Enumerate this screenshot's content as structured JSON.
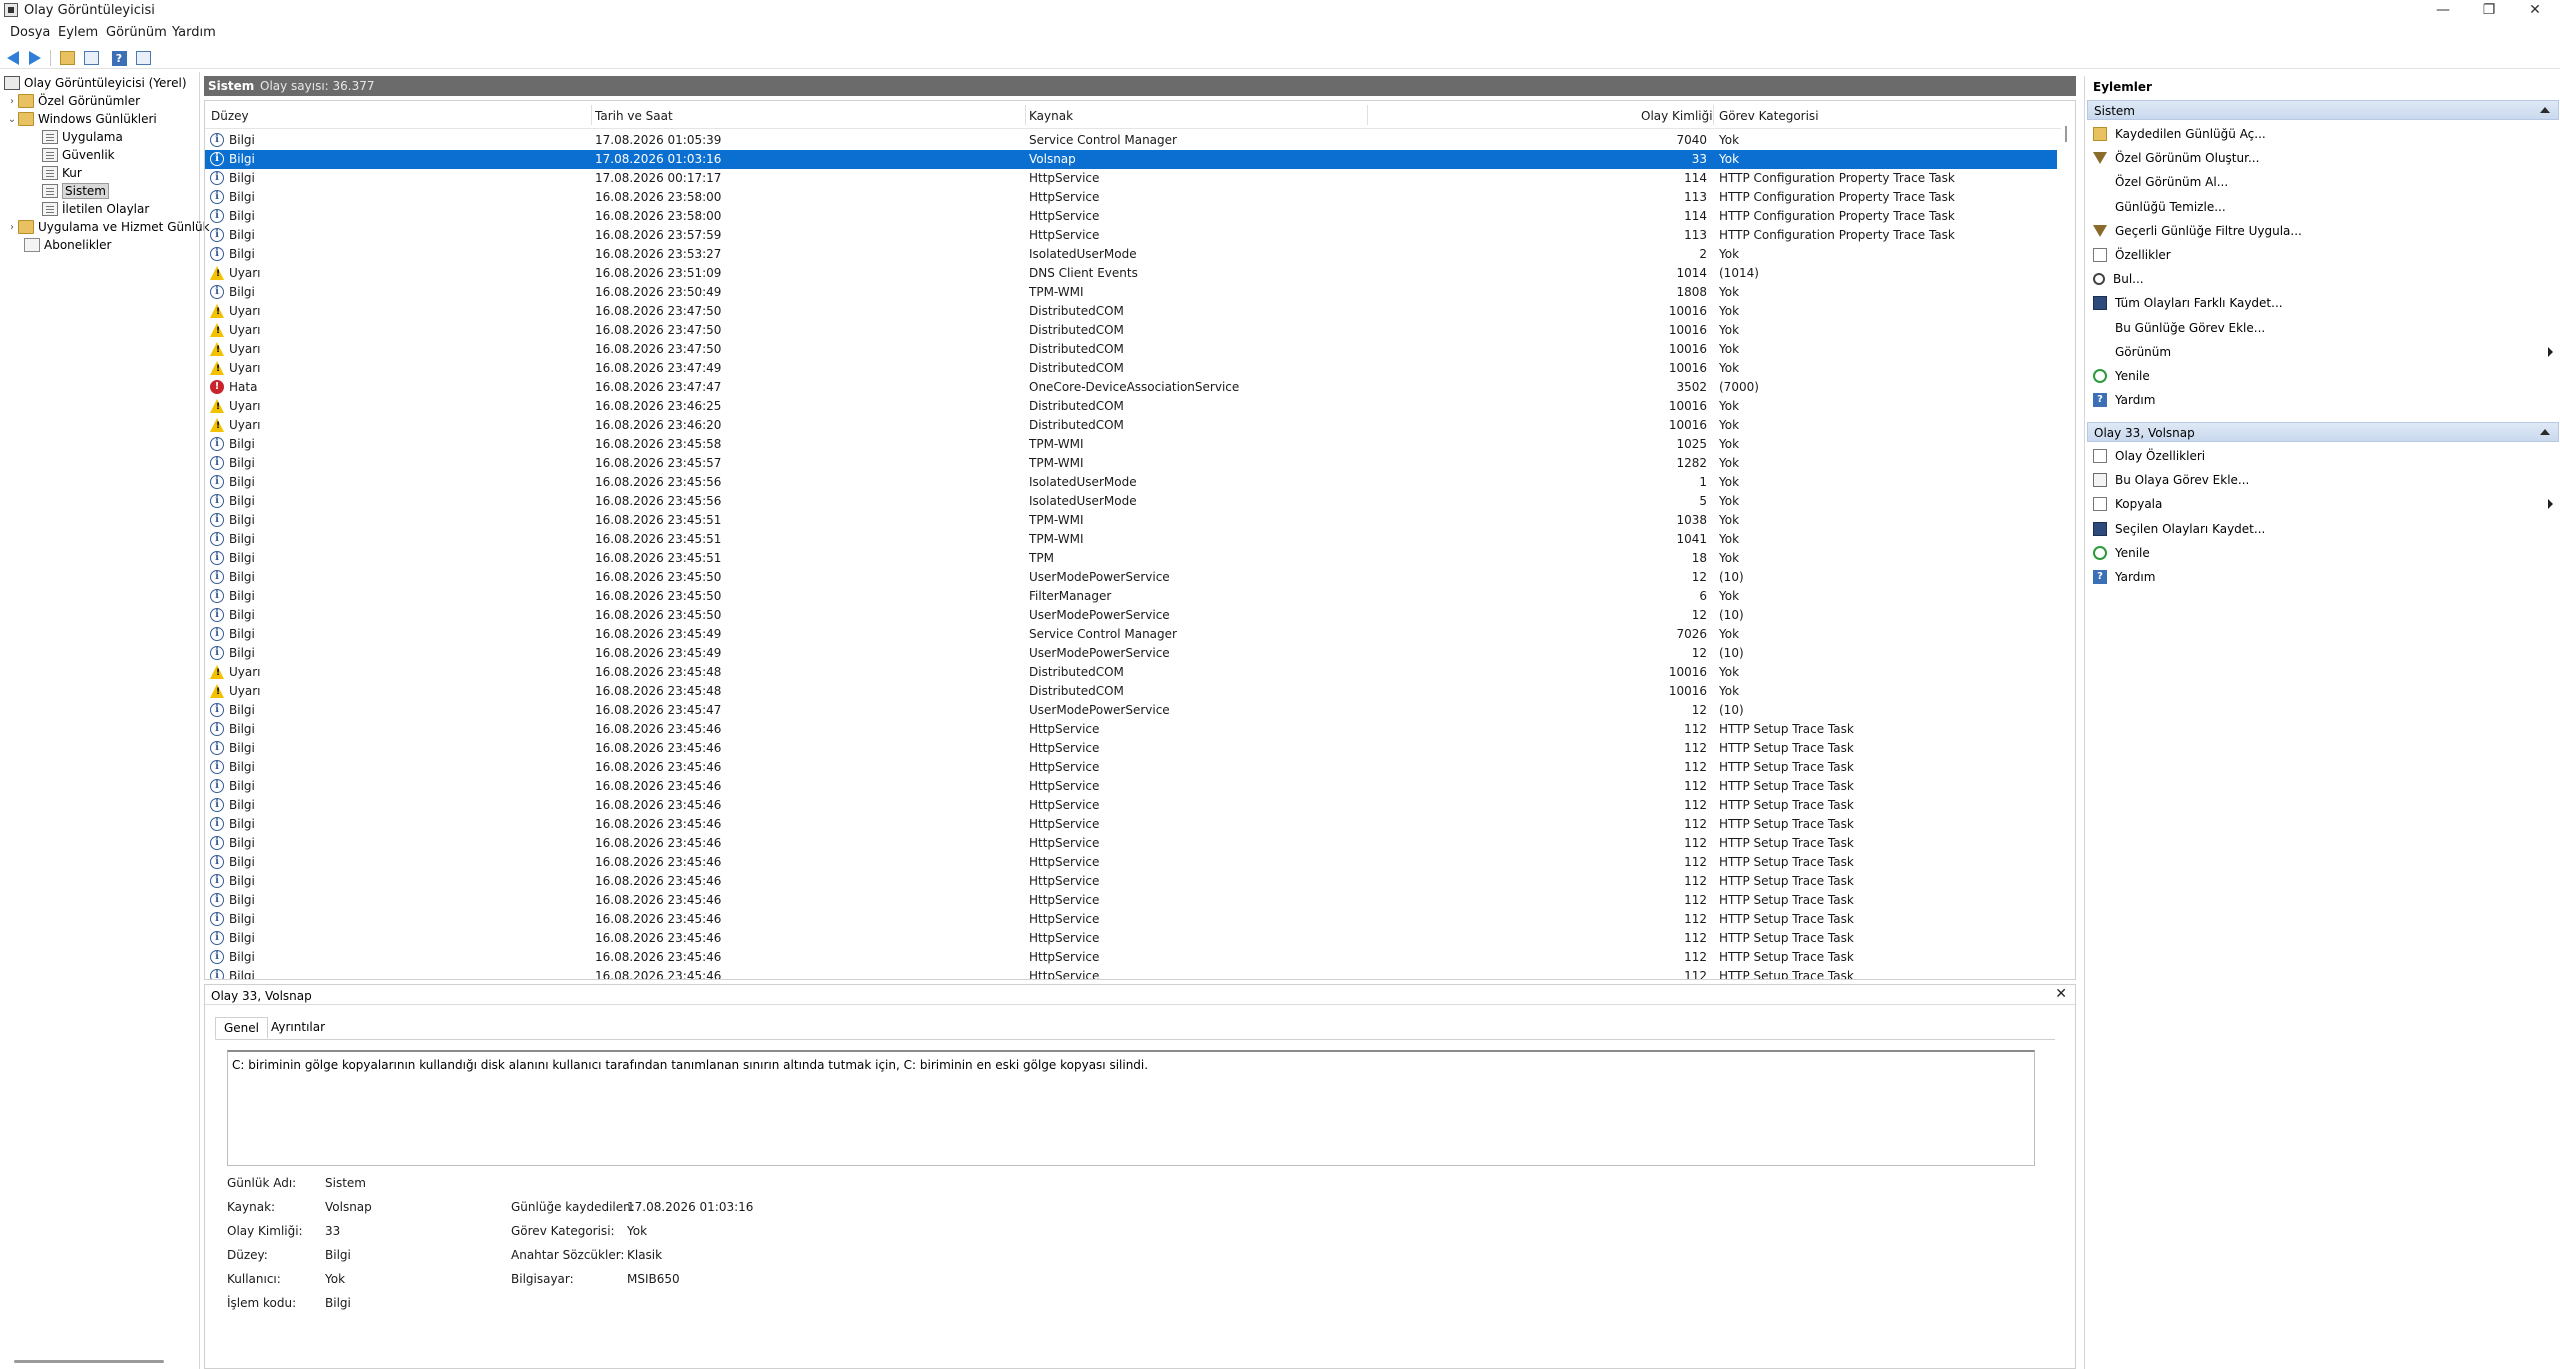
{
  "window": {
    "title": "Olay Görüntüleyicisi",
    "controls": [
      "—",
      "❐",
      "✕"
    ]
  },
  "menu": [
    "Dosya",
    "Eylem",
    "Görünüm",
    "Yardım"
  ],
  "tree": {
    "root": "Olay Görüntüleyicisi (Yerel)",
    "custom_views": "Özel Görünümler",
    "windows_logs": "Windows Günlükleri",
    "logs": [
      "Uygulama",
      "Güvenlik",
      "Kur",
      "Sistem",
      "İletilen Olaylar"
    ],
    "apps_services": "Uygulama ve Hizmet Günlük",
    "subscriptions": "Abonelikler"
  },
  "center": {
    "title": "Sistem",
    "count_text": "Olay sayısı: 36.377"
  },
  "columns": {
    "level": "Düzey",
    "date": "Tarih ve Saat",
    "source": "Kaynak",
    "event_id": "Olay Kimliği",
    "category": "Görev Kategorisi"
  },
  "events": [
    {
      "level": "info",
      "level_text": "Bilgi",
      "date": "17.08.2026 01:05:39",
      "source": "Service Control Manager",
      "id": "7040",
      "cat": "Yok"
    },
    {
      "level": "info",
      "level_text": "Bilgi",
      "date": "17.08.2026 01:03:16",
      "source": "Volsnap",
      "id": "33",
      "cat": "Yok",
      "selected": true
    },
    {
      "level": "info",
      "level_text": "Bilgi",
      "date": "17.08.2026 00:17:17",
      "source": "HttpService",
      "id": "114",
      "cat": "HTTP Configuration Property Trace Task"
    },
    {
      "level": "info",
      "level_text": "Bilgi",
      "date": "16.08.2026 23:58:00",
      "source": "HttpService",
      "id": "113",
      "cat": "HTTP Configuration Property Trace Task"
    },
    {
      "level": "info",
      "level_text": "Bilgi",
      "date": "16.08.2026 23:58:00",
      "source": "HttpService",
      "id": "114",
      "cat": "HTTP Configuration Property Trace Task"
    },
    {
      "level": "info",
      "level_text": "Bilgi",
      "date": "16.08.2026 23:57:59",
      "source": "HttpService",
      "id": "113",
      "cat": "HTTP Configuration Property Trace Task"
    },
    {
      "level": "info",
      "level_text": "Bilgi",
      "date": "16.08.2026 23:53:27",
      "source": "IsolatedUserMode",
      "id": "2",
      "cat": "Yok"
    },
    {
      "level": "warn",
      "level_text": "Uyarı",
      "date": "16.08.2026 23:51:09",
      "source": "DNS Client Events",
      "id": "1014",
      "cat": "(1014)"
    },
    {
      "level": "info",
      "level_text": "Bilgi",
      "date": "16.08.2026 23:50:49",
      "source": "TPM-WMI",
      "id": "1808",
      "cat": "Yok"
    },
    {
      "level": "warn",
      "level_text": "Uyarı",
      "date": "16.08.2026 23:47:50",
      "source": "DistributedCOM",
      "id": "10016",
      "cat": "Yok"
    },
    {
      "level": "warn",
      "level_text": "Uyarı",
      "date": "16.08.2026 23:47:50",
      "source": "DistributedCOM",
      "id": "10016",
      "cat": "Yok"
    },
    {
      "level": "warn",
      "level_text": "Uyarı",
      "date": "16.08.2026 23:47:50",
      "source": "DistributedCOM",
      "id": "10016",
      "cat": "Yok"
    },
    {
      "level": "warn",
      "level_text": "Uyarı",
      "date": "16.08.2026 23:47:49",
      "source": "DistributedCOM",
      "id": "10016",
      "cat": "Yok"
    },
    {
      "level": "error",
      "level_text": "Hata",
      "date": "16.08.2026 23:47:47",
      "source": "OneCore-DeviceAssociationService",
      "id": "3502",
      "cat": "(7000)"
    },
    {
      "level": "warn",
      "level_text": "Uyarı",
      "date": "16.08.2026 23:46:25",
      "source": "DistributedCOM",
      "id": "10016",
      "cat": "Yok"
    },
    {
      "level": "warn",
      "level_text": "Uyarı",
      "date": "16.08.2026 23:46:20",
      "source": "DistributedCOM",
      "id": "10016",
      "cat": "Yok"
    },
    {
      "level": "info",
      "level_text": "Bilgi",
      "date": "16.08.2026 23:45:58",
      "source": "TPM-WMI",
      "id": "1025",
      "cat": "Yok"
    },
    {
      "level": "info",
      "level_text": "Bilgi",
      "date": "16.08.2026 23:45:57",
      "source": "TPM-WMI",
      "id": "1282",
      "cat": "Yok"
    },
    {
      "level": "info",
      "level_text": "Bilgi",
      "date": "16.08.2026 23:45:56",
      "source": "IsolatedUserMode",
      "id": "1",
      "cat": "Yok"
    },
    {
      "level": "info",
      "level_text": "Bilgi",
      "date": "16.08.2026 23:45:56",
      "source": "IsolatedUserMode",
      "id": "5",
      "cat": "Yok"
    },
    {
      "level": "info",
      "level_text": "Bilgi",
      "date": "16.08.2026 23:45:51",
      "source": "TPM-WMI",
      "id": "1038",
      "cat": "Yok"
    },
    {
      "level": "info",
      "level_text": "Bilgi",
      "date": "16.08.2026 23:45:51",
      "source": "TPM-WMI",
      "id": "1041",
      "cat": "Yok"
    },
    {
      "level": "info",
      "level_text": "Bilgi",
      "date": "16.08.2026 23:45:51",
      "source": "TPM",
      "id": "18",
      "cat": "Yok"
    },
    {
      "level": "info",
      "level_text": "Bilgi",
      "date": "16.08.2026 23:45:50",
      "source": "UserModePowerService",
      "id": "12",
      "cat": "(10)"
    },
    {
      "level": "info",
      "level_text": "Bilgi",
      "date": "16.08.2026 23:45:50",
      "source": "FilterManager",
      "id": "6",
      "cat": "Yok"
    },
    {
      "level": "info",
      "level_text": "Bilgi",
      "date": "16.08.2026 23:45:50",
      "source": "UserModePowerService",
      "id": "12",
      "cat": "(10)"
    },
    {
      "level": "info",
      "level_text": "Bilgi",
      "date": "16.08.2026 23:45:49",
      "source": "Service Control Manager",
      "id": "7026",
      "cat": "Yok"
    },
    {
      "level": "info",
      "level_text": "Bilgi",
      "date": "16.08.2026 23:45:49",
      "source": "UserModePowerService",
      "id": "12",
      "cat": "(10)"
    },
    {
      "level": "warn",
      "level_text": "Uyarı",
      "date": "16.08.2026 23:45:48",
      "source": "DistributedCOM",
      "id": "10016",
      "cat": "Yok"
    },
    {
      "level": "warn",
      "level_text": "Uyarı",
      "date": "16.08.2026 23:45:48",
      "source": "DistributedCOM",
      "id": "10016",
      "cat": "Yok"
    },
    {
      "level": "info",
      "level_text": "Bilgi",
      "date": "16.08.2026 23:45:47",
      "source": "UserModePowerService",
      "id": "12",
      "cat": "(10)"
    },
    {
      "level": "info",
      "level_text": "Bilgi",
      "date": "16.08.2026 23:45:46",
      "source": "HttpService",
      "id": "112",
      "cat": "HTTP Setup Trace Task"
    },
    {
      "level": "info",
      "level_text": "Bilgi",
      "date": "16.08.2026 23:45:46",
      "source": "HttpService",
      "id": "112",
      "cat": "HTTP Setup Trace Task"
    },
    {
      "level": "info",
      "level_text": "Bilgi",
      "date": "16.08.2026 23:45:46",
      "source": "HttpService",
      "id": "112",
      "cat": "HTTP Setup Trace Task"
    },
    {
      "level": "info",
      "level_text": "Bilgi",
      "date": "16.08.2026 23:45:46",
      "source": "HttpService",
      "id": "112",
      "cat": "HTTP Setup Trace Task"
    },
    {
      "level": "info",
      "level_text": "Bilgi",
      "date": "16.08.2026 23:45:46",
      "source": "HttpService",
      "id": "112",
      "cat": "HTTP Setup Trace Task"
    },
    {
      "level": "info",
      "level_text": "Bilgi",
      "date": "16.08.2026 23:45:46",
      "source": "HttpService",
      "id": "112",
      "cat": "HTTP Setup Trace Task"
    },
    {
      "level": "info",
      "level_text": "Bilgi",
      "date": "16.08.2026 23:45:46",
      "source": "HttpService",
      "id": "112",
      "cat": "HTTP Setup Trace Task"
    },
    {
      "level": "info",
      "level_text": "Bilgi",
      "date": "16.08.2026 23:45:46",
      "source": "HttpService",
      "id": "112",
      "cat": "HTTP Setup Trace Task"
    },
    {
      "level": "info",
      "level_text": "Bilgi",
      "date": "16.08.2026 23:45:46",
      "source": "HttpService",
      "id": "112",
      "cat": "HTTP Setup Trace Task"
    },
    {
      "level": "info",
      "level_text": "Bilgi",
      "date": "16.08.2026 23:45:46",
      "source": "HttpService",
      "id": "112",
      "cat": "HTTP Setup Trace Task"
    },
    {
      "level": "info",
      "level_text": "Bilgi",
      "date": "16.08.2026 23:45:46",
      "source": "HttpService",
      "id": "112",
      "cat": "HTTP Setup Trace Task"
    },
    {
      "level": "info",
      "level_text": "Bilgi",
      "date": "16.08.2026 23:45:46",
      "source": "HttpService",
      "id": "112",
      "cat": "HTTP Setup Trace Task"
    },
    {
      "level": "info",
      "level_text": "Bilgi",
      "date": "16.08.2026 23:45:46",
      "source": "HttpService",
      "id": "112",
      "cat": "HTTP Setup Trace Task"
    },
    {
      "level": "info",
      "level_text": "Bilgi",
      "date": "16.08.2026 23:45:46",
      "source": "HttpService",
      "id": "112",
      "cat": "HTTP Setup Trace Task"
    }
  ],
  "detail": {
    "title": "Olay 33, Volsnap",
    "close": "✕",
    "tabs": [
      "Genel",
      "Ayrıntılar"
    ],
    "message": "C: biriminin gölge kopyalarının kullandığı disk alanını kullanıcı tarafından tanımlanan sınırın altında tutmak için, C: biriminin en eski gölge kopyası silindi.",
    "fields_left": [
      {
        "label": "Günlük Adı:",
        "value": "Sistem"
      },
      {
        "label": "Kaynak:",
        "value": "Volsnap"
      },
      {
        "label": "Olay Kimliği:",
        "value": "33"
      },
      {
        "label": "Düzey:",
        "value": "Bilgi"
      },
      {
        "label": "Kullanıcı:",
        "value": "Yok"
      },
      {
        "label": "İşlem kodu:",
        "value": "Bilgi"
      }
    ],
    "fields_right": [
      {
        "label": "Günlüğe kaydedilen:",
        "value": "17.08.2026 01:03:16"
      },
      {
        "label": "Görev Kategorisi:",
        "value": "Yok"
      },
      {
        "label": "Anahtar Sözcükler:",
        "value": "Klasik"
      },
      {
        "label": "Bilgisayar:",
        "value": "MSIB650"
      }
    ]
  },
  "actions": {
    "title": "Eylemler",
    "section1": "Sistem",
    "items1": [
      {
        "label": "Kaydedilen Günlüğü Aç...",
        "icon": "open-folder-icon"
      },
      {
        "label": "Özel Görünüm Oluştur...",
        "icon": "filter-icon"
      },
      {
        "label": "Özel Görünüm Al...",
        "icon": "none"
      },
      {
        "label": "Günlüğü Temizle...",
        "icon": "none"
      },
      {
        "label": "Geçerli Günlüğe Filtre Uygula...",
        "icon": "filter-icon"
      },
      {
        "label": "Özellikler",
        "icon": "page-icon"
      },
      {
        "label": "Bul...",
        "icon": "find-icon"
      },
      {
        "label": "Tüm Olayları Farklı Kaydet...",
        "icon": "save-icon"
      },
      {
        "label": "Bu Günlüğe Görev Ekle...",
        "icon": "none"
      },
      {
        "label": "Görünüm",
        "icon": "none",
        "submenu": true
      },
      {
        "label": "Yenile",
        "icon": "refresh-icon"
      },
      {
        "label": "Yardım",
        "icon": "help-icon"
      }
    ],
    "section2": "Olay 33, Volsnap",
    "items2": [
      {
        "label": "Olay Özellikleri",
        "icon": "page-icon"
      },
      {
        "label": "Bu Olaya Görev Ekle...",
        "icon": "task-icon"
      },
      {
        "label": "Kopyala",
        "icon": "page-icon",
        "submenu": true
      },
      {
        "label": "Seçilen Olayları Kaydet...",
        "icon": "save-icon"
      },
      {
        "label": "Yenile",
        "icon": "refresh-icon"
      },
      {
        "label": "Yardım",
        "icon": "help-icon"
      }
    ]
  },
  "colors": {
    "selection": "#0b6fd1",
    "header_bar": "#6b6b6b",
    "section_bar": "#dfe9f6",
    "warning": "#f2c200",
    "error": "#c9232b"
  }
}
